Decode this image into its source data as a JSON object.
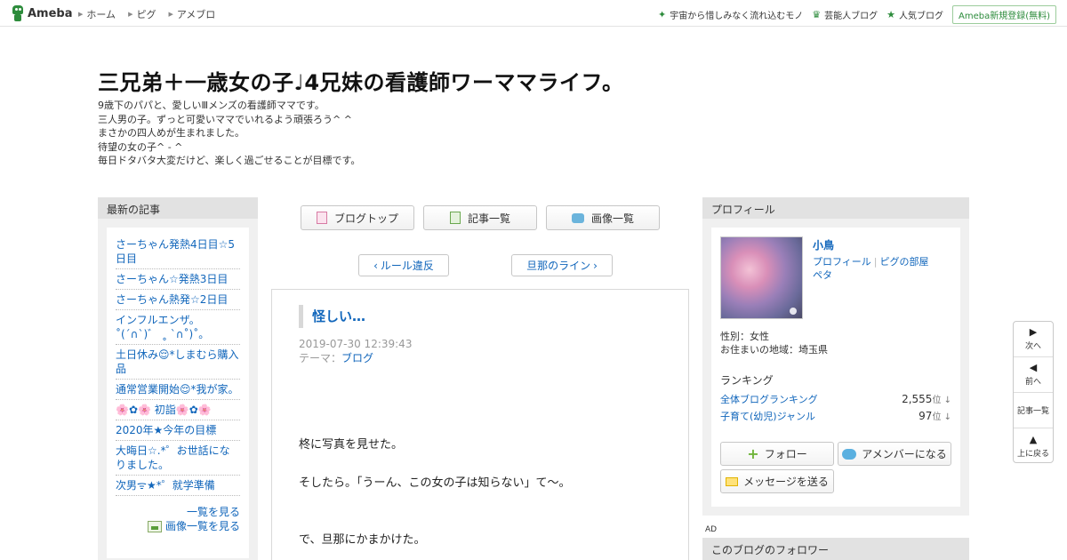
{
  "topbar": {
    "logo_text": "Ameba",
    "nav": [
      "ホーム",
      "ピグ",
      "アメブロ"
    ],
    "right_links": [
      {
        "icon": "sparkle-icon",
        "label": "宇宙から惜しみなく流れ込むモノ"
      },
      {
        "icon": "crown-icon",
        "label": "芸能人ブログ"
      },
      {
        "icon": "star-icon",
        "label": "人気ブログ"
      }
    ],
    "register_label": "Ameba新規登録(無料)"
  },
  "header": {
    "title": "三兄弟＋一歳女の子♩4兄妹の看護師ワーママライフ。",
    "description": [
      "9歳下のパパと、愛しいⅢメンズの看護師ママです。",
      "三人男の子。ずっと可愛いママでいれるよう頑張ろう^ ^",
      "まさかの四人めが生まれました。",
      "待望の女の子^ - ^",
      "毎日ドタバタ大変だけど、楽しく過ごせることが目標です。"
    ]
  },
  "left": {
    "heading": "最新の記事",
    "recent": [
      "さーちゃん発熱4日目☆5日目",
      "さーちゃん☆発熱3日目",
      "さーちゃん熱発☆2日目",
      "インフルエンザ。˚(ˊ∩ˋ)゛ ˳ `∩˚)˚。",
      "土日休み😌*しまむら購入品",
      "通常営業開始😌*我が家。",
      "🌸✿🌸 初詣🌸✿🌸",
      "2020年★今年の目標",
      "大晦日☆.*゜お世話になりました。",
      "次男ᯤ★*゜就学準備"
    ],
    "more_list": "一覧を見る",
    "more_images": "画像一覧を見る"
  },
  "center": {
    "nav": {
      "top": "ブログトップ",
      "list": "記事一覧",
      "images": "画像一覧"
    },
    "prev": "ルール違反",
    "next": "旦那のライン",
    "article": {
      "title": "怪しい…",
      "date": "2019-07-30 12:39:43",
      "theme_label": "テーマ：",
      "theme": "ブログ",
      "body": [
        "柊に写真を見せた。",
        "そしたら。「うーん、この女の子は知らない」て〜。",
        "で、旦那にかまかけた。"
      ]
    }
  },
  "right": {
    "heading": "プロフィール",
    "name": "小鳥",
    "links": [
      "プロフィール",
      "ピグの部屋",
      "ペタ"
    ],
    "gender": "性別：女性",
    "area": "お住まいの地域：埼玉県",
    "ranking_label": "ランキング",
    "rankings": [
      {
        "label": "全体ブログランキング",
        "value": "2,555",
        "unit": "位 ↓"
      },
      {
        "label": "子育て(幼児)ジャンル",
        "value": "97",
        "unit": "位 ↓"
      }
    ],
    "follow": "フォロー",
    "amember": "アメンバーになる",
    "message": "メッセージを送る",
    "ad": "AD",
    "followers_heading": "このブログのフォロワー"
  },
  "sidenav": {
    "next": "次へ",
    "prev": "前へ",
    "list": "記事一覧",
    "top": "上に戻る"
  }
}
